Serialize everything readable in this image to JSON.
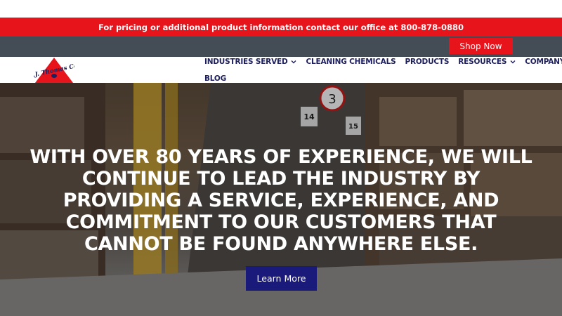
{
  "promo": {
    "text": "For pricing or additional product information contact our office at 800-878-0880"
  },
  "shop": {
    "label": "Shop Now"
  },
  "logo": {
    "text": "E.J. Thomas Co."
  },
  "nav": {
    "items": [
      {
        "label": "INDUSTRIES SERVED",
        "dropdown": true
      },
      {
        "label": "CLEANING CHEMICALS",
        "dropdown": false
      },
      {
        "label": "PRODUCTS",
        "dropdown": false
      },
      {
        "label": "RESOURCES",
        "dropdown": true
      },
      {
        "label": "COMPANY",
        "dropdown": true
      }
    ],
    "blog": "BLOG"
  },
  "hero": {
    "headline": "WITH OVER 80 YEARS OF EXPERIENCE, WE WILL CONTINUE TO LEAD THE INDUSTRY BY PROVIDING A SERVICE, EXPERIENCE, AND COMMITMENT TO OUR CUSTOMERS THAT CANNOT BE FOUND ANYWHERE ELSE.",
    "button": "Learn More",
    "signs": [
      "3",
      "14",
      "15"
    ]
  },
  "colors": {
    "red": "#e8141c",
    "navy": "#1d1f5e",
    "button": "#1a1a7a",
    "bar": "#444c55"
  }
}
